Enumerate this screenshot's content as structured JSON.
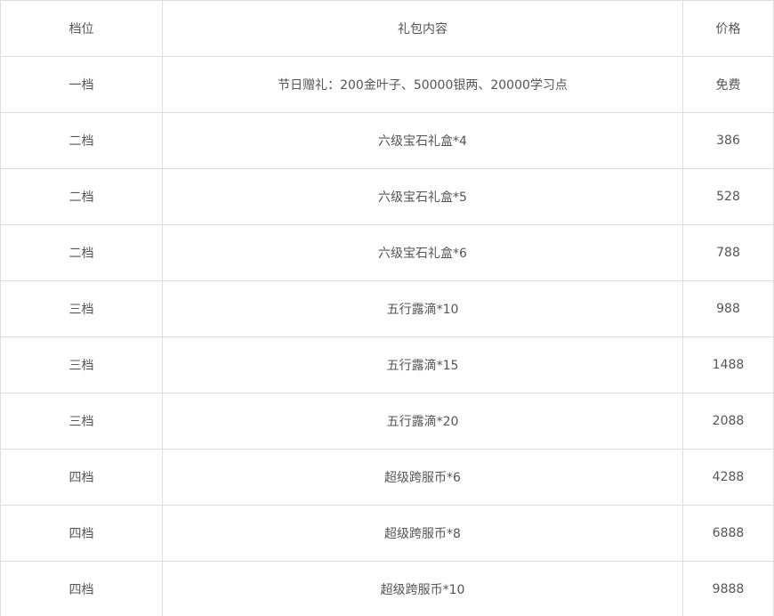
{
  "table": {
    "headers": [
      "档位",
      "礼包内容",
      "价格"
    ],
    "rows": [
      {
        "tier": "一档",
        "content": "节日赠礼：200金叶子、50000银两、20000学习点",
        "price": "免费"
      },
      {
        "tier": "二档",
        "content": "六级宝石礼盒*4",
        "price": "386"
      },
      {
        "tier": "二档",
        "content": "六级宝石礼盒*5",
        "price": "528"
      },
      {
        "tier": "二档",
        "content": "六级宝石礼盒*6",
        "price": "788"
      },
      {
        "tier": "三档",
        "content": "五行露滴*10",
        "price": "988"
      },
      {
        "tier": "三档",
        "content": "五行露滴*15",
        "price": "1488"
      },
      {
        "tier": "三档",
        "content": "五行露滴*20",
        "price": "2088"
      },
      {
        "tier": "四档",
        "content": "超级跨服币*6",
        "price": "4288"
      },
      {
        "tier": "四档",
        "content": "超级跨服币*8",
        "price": "6888"
      },
      {
        "tier": "四档",
        "content": "超级跨服币*10",
        "price": "9888"
      }
    ]
  },
  "colors": {
    "border": "#dddddd",
    "text": "#555555",
    "background": "#ffffff"
  }
}
